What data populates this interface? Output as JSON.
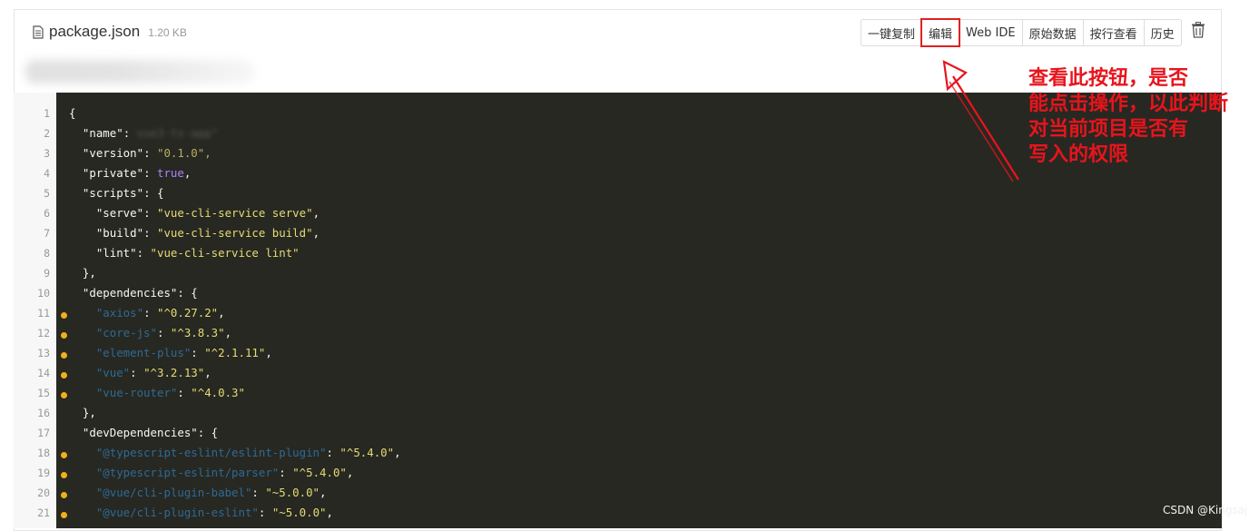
{
  "file": {
    "name": "package.json",
    "size": "1.20 KB",
    "icon": "file-text-icon"
  },
  "toolbar": {
    "buttons": [
      {
        "label": "一键复制",
        "name": "copy-all-button"
      },
      {
        "label": "编辑",
        "name": "edit-button"
      },
      {
        "label": "Web IDE",
        "name": "web-ide-button"
      },
      {
        "label": "原始数据",
        "name": "raw-data-button"
      },
      {
        "label": "按行查看",
        "name": "view-by-line-button"
      },
      {
        "label": "历史",
        "name": "history-button"
      }
    ],
    "highlighted": "编辑",
    "delete_icon": "trash-icon"
  },
  "code": {
    "lines": [
      {
        "n": "1",
        "marked": false
      },
      {
        "n": "2",
        "marked": false
      },
      {
        "n": "3",
        "marked": false
      },
      {
        "n": "4",
        "marked": false
      },
      {
        "n": "5",
        "marked": false
      },
      {
        "n": "6",
        "marked": false
      },
      {
        "n": "7",
        "marked": false
      },
      {
        "n": "8",
        "marked": false
      },
      {
        "n": "9",
        "marked": false
      },
      {
        "n": "10",
        "marked": false
      },
      {
        "n": "11",
        "marked": true
      },
      {
        "n": "12",
        "marked": true
      },
      {
        "n": "13",
        "marked": true
      },
      {
        "n": "14",
        "marked": true
      },
      {
        "n": "15",
        "marked": true
      },
      {
        "n": "16",
        "marked": false
      },
      {
        "n": "17",
        "marked": false
      },
      {
        "n": "18",
        "marked": true
      },
      {
        "n": "19",
        "marked": true
      },
      {
        "n": "20",
        "marked": true
      },
      {
        "n": "21",
        "marked": true
      }
    ],
    "l1": "{",
    "l2_key": "\"name\"",
    "l2_val": "vue3-ts-app\"",
    "l3_key": "\"version\"",
    "l3_val": "\"0.1.0\",",
    "l4_key": "\"private\"",
    "l4_val": "true",
    "l5_key": "\"scripts\"",
    "l6_key": "\"serve\"",
    "l6_val": "\"vue-cli-service serve\"",
    "l7_key": "\"build\"",
    "l7_val": "\"vue-cli-service build\"",
    "l8_key": "\"lint\"",
    "l8_val": "\"vue-cli-service lint\"",
    "l9": "},",
    "l10_key": "\"dependencies\"",
    "l11_key": "\"axios\"",
    "l11_val": "\"^0.27.2\"",
    "l12_key": "\"core-js\"",
    "l12_val": "\"^3.8.3\"",
    "l13_key": "\"element-plus\"",
    "l13_val": "\"^2.1.11\"",
    "l14_key": "\"vue\"",
    "l14_val": "\"^3.2.13\"",
    "l15_key": "\"vue-router\"",
    "l15_val": "\"^4.0.3\"",
    "l16": "},",
    "l17_key": "\"devDependencies\"",
    "l18_key": "\"@typescript-eslint/eslint-plugin\"",
    "l18_val": "\"^5.4.0\"",
    "l19_key": "\"@typescript-eslint/parser\"",
    "l19_val": "\"^5.4.0\"",
    "l20_key": "\"@vue/cli-plugin-babel\"",
    "l20_val": "\"~5.0.0\"",
    "l21_key": "\"@vue/cli-plugin-eslint\"",
    "l21_val": "\"~5.0.0\""
  },
  "annotation": {
    "lines": [
      "查看此按钮，是否",
      "能点击操作，以此判断",
      "对当前项目是否有",
      "写入的权限"
    ],
    "color": "#e8141c"
  },
  "watermark": "CSDN @Kingsaj"
}
